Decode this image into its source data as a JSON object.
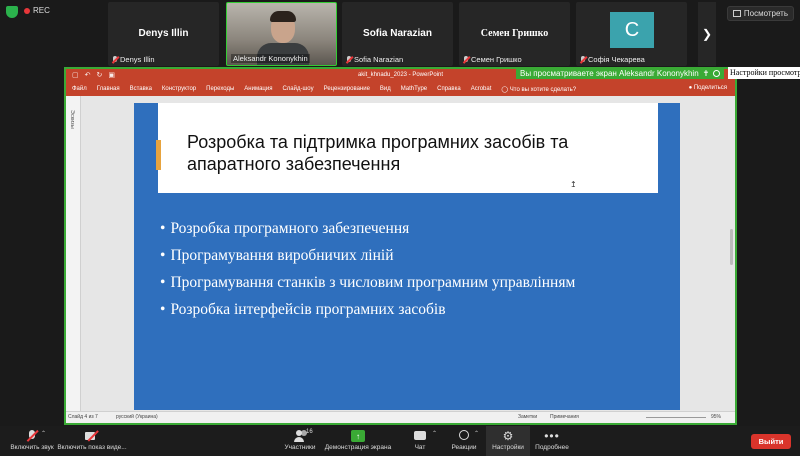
{
  "top": {
    "rec_label": "REC",
    "view_button": "Посмотреть"
  },
  "participants": [
    {
      "display": "Denys Illin",
      "label": "Denys Illin"
    },
    {
      "display": "",
      "label": "Aleksandr Kononykhin"
    },
    {
      "display": "Sofia Narazian",
      "label": "Sofia Narazian"
    },
    {
      "display": "Семен Гришко",
      "label": "Семен Гришко"
    },
    {
      "display": "C",
      "label": "Софія Чекарева"
    }
  ],
  "share": {
    "banner_text": "Вы просматриваете экран Aleksandr Kononykhin",
    "settings_text": "Настройки просмотра"
  },
  "powerpoint": {
    "window_title": "akit_khnadu_2023  -  PowerPoint",
    "ribbon_tabs": [
      "Файл",
      "Главная",
      "Вставка",
      "Конструктор",
      "Переходы",
      "Анимация",
      "Слайд-шоу",
      "Рецензирование",
      "Вид",
      "MathType",
      "Справка",
      "Acrobat",
      "Что вы хотите сделать?"
    ],
    "share_label": "Поделиться",
    "thumbs_label": "Эскизы",
    "slide": {
      "title": "Розробка та підтримка програмних засобів та апаратного забезпечення",
      "bullets": [
        "Розробка програмного забезпечення",
        "Програмування виробничих ліній",
        "Програмування станків з числовим програмним управлінням",
        "Розробка інтерфейсів програмних засобів"
      ]
    },
    "status": {
      "slide_counter": "Слайд 4 из 7",
      "language": "русский (Украина)",
      "notes": "Заметки",
      "comments": "Примечания",
      "zoom": "95%"
    }
  },
  "toolbar": {
    "unmute": "Включить звук",
    "start_video": "Включить показ виде...",
    "participants": "Участники",
    "participants_count": "16",
    "share_screen": "Демонстрация экрана",
    "chat": "Чат",
    "reactions": "Реакции",
    "settings": "Настройки",
    "more": "Подробнее",
    "leave": "Выйти"
  }
}
